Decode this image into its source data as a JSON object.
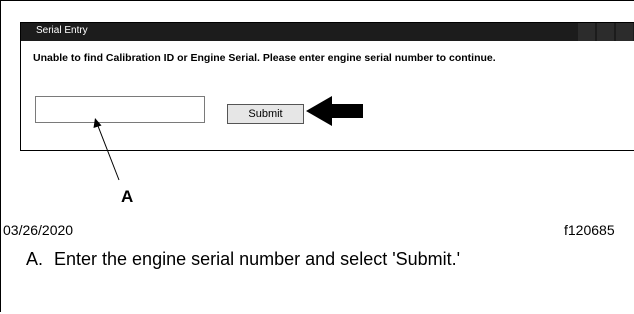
{
  "window": {
    "title": "Serial Entry",
    "message": "Unable to find Calibration ID or Engine Serial. Please enter engine serial number to continue.",
    "serial_input_value": "",
    "submit_label": "Submit"
  },
  "figure": {
    "callout_letter": "A",
    "date": "03/26/2020",
    "figure_id": "f120685",
    "caption_marker": "A.",
    "caption_text": "Enter the engine serial number and select 'Submit.'"
  },
  "colors": {
    "titlebar": "#1c1c1c",
    "arrow": "#000000"
  }
}
